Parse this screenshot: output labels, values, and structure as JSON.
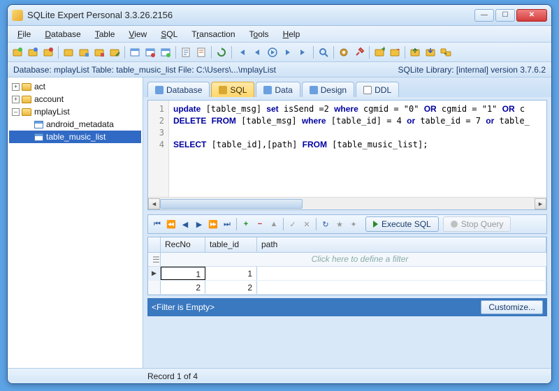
{
  "window": {
    "title": "SQLite Expert Personal 3.3.26.2156"
  },
  "menu": [
    "File",
    "Database",
    "Table",
    "View",
    "SQL",
    "Transaction",
    "Tools",
    "Help"
  ],
  "info": {
    "left": "Database: mplayList   Table: table_music_list   File: C:\\Users\\...\\mplayList",
    "right": "SQLite Library: [internal] version 3.7.6.2"
  },
  "tree": {
    "dbs": [
      {
        "name": "act",
        "expanded": false
      },
      {
        "name": "account",
        "expanded": false
      },
      {
        "name": "mplayList",
        "expanded": true,
        "tables": [
          "android_metadata",
          "table_music_list"
        ],
        "selected": "table_music_list"
      }
    ]
  },
  "tabs": [
    {
      "label": "Database"
    },
    {
      "label": "SQL",
      "active": true
    },
    {
      "label": "Data"
    },
    {
      "label": "Design"
    },
    {
      "label": "DDL"
    }
  ],
  "sql": {
    "lines": [
      "update [table_msg] set isSend =2 where cgmid = \"0\" OR cgmid = \"1\" OR c",
      "DELETE FROM [table_msg] where [table_id] = 4 or table_id = 7 or table_",
      "",
      "SELECT [table_id],[path] FROM [table_music_list];"
    ]
  },
  "midbar": {
    "execute": "Execute SQL",
    "stop": "Stop Query"
  },
  "grid": {
    "columns": [
      "RecNo",
      "table_id",
      "path"
    ],
    "filter_hint": "Click here to define a filter",
    "rows": [
      {
        "RecNo": 1,
        "table_id": 1,
        "path": "",
        "current": true
      },
      {
        "RecNo": 2,
        "table_id": 2,
        "path": ""
      }
    ]
  },
  "filter": {
    "text": "<Filter is Empty>",
    "customize": "Customize..."
  },
  "status": "Record 1 of 4"
}
